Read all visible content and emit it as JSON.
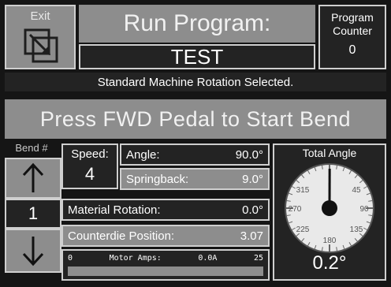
{
  "header": {
    "exit_label": "Exit",
    "title": "Run Program:",
    "program_name": "TEST",
    "counter_label_1": "Program",
    "counter_label_2": "Counter",
    "counter_value": "0"
  },
  "status_banner": "Standard Machine Rotation Selected.",
  "instruction": "Press FWD Pedal to Start Bend",
  "bend": {
    "label": "Bend #",
    "value": "1"
  },
  "speed": {
    "label": "Speed:",
    "value": "4"
  },
  "angle": {
    "label": "Angle:",
    "value": "90.0°"
  },
  "springback": {
    "label": "Springback:",
    "value": "9.0°"
  },
  "material_rotation": {
    "label": "Material Rotation:",
    "value": "0.0°"
  },
  "counterdie": {
    "label": "Counterdie Position:",
    "value": "3.07"
  },
  "motor": {
    "min": "0",
    "label": "Motor Amps:",
    "value": "0.0A",
    "max": "25",
    "fraction": 0.0
  },
  "total_angle": {
    "label": "Total Angle",
    "value": "0.2°",
    "needle_deg": 0.2,
    "dial_labels": [
      "315",
      "45",
      "270",
      "90",
      "225",
      "135",
      "180"
    ]
  },
  "colors": {
    "panel_gray": "#8d8d8d",
    "panel_dark": "#232323",
    "text": "#ffffff"
  }
}
